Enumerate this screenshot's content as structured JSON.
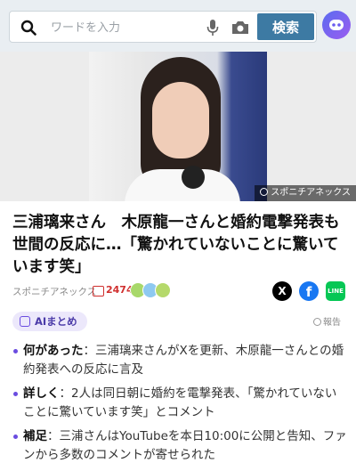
{
  "search": {
    "placeholder": "ワードを入力",
    "button_label": "検索",
    "icons": [
      "search-icon",
      "mic-icon",
      "camera-icon",
      "assistant-icon"
    ]
  },
  "hero": {
    "credit": "スポニチアネックス"
  },
  "article": {
    "title": "三浦璃来さん　木原龍一さんと婚約電撃発表も世間の反応に…「驚かれていないことに驚いています笑」",
    "source": "スポニチアネックス",
    "comment_count": "2474"
  },
  "ai_summary": {
    "badge": "AIまとめ",
    "report": "報告",
    "items": [
      {
        "label": "何があった",
        "text": "：三浦璃来さんがXを更新、木原龍一さんとの婚約発表への反応に言及"
      },
      {
        "label": "詳しく",
        "text": "：2人は同日朝に婚約を電撃発表、「驚かれていないことに驚いています笑」とコメント"
      },
      {
        "label": "補足",
        "text": "：三浦さんはYouTubeを本日10:00に公開と告知、ファンから多数のコメントが寄せられた"
      }
    ]
  },
  "colors": {
    "search_button": "#3d7aa3",
    "comment": "#d0302f",
    "ai_accent": "#6a4ce0",
    "facebook": "#1877f2",
    "line": "#06c755"
  }
}
